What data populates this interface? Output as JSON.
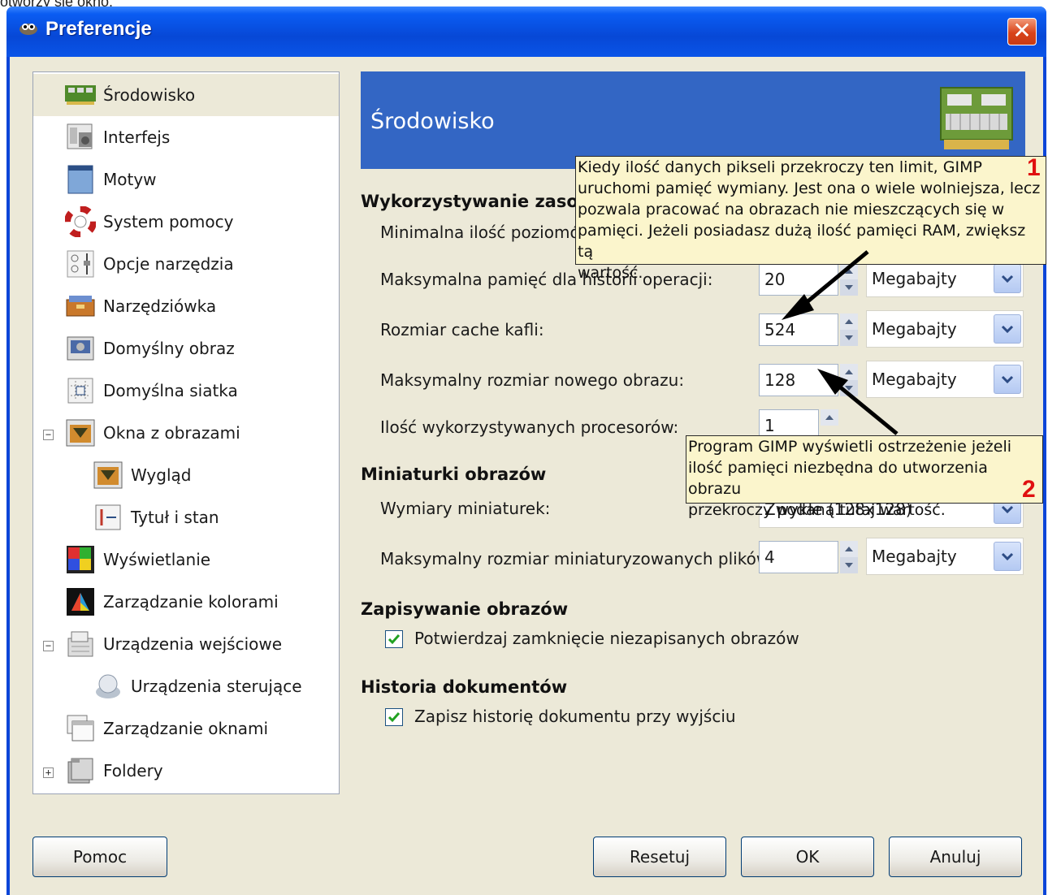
{
  "caption": "otworzy się okno:",
  "window": {
    "title": "Preferencje",
    "close": "✕"
  },
  "sidebar": {
    "items": [
      {
        "label": "Środowisko",
        "icon": "memory-chip-icon"
      },
      {
        "label": "Interfejs",
        "icon": "interface-icon"
      },
      {
        "label": "Motyw",
        "icon": "theme-icon"
      },
      {
        "label": "System pomocy",
        "icon": "lifebuoy-icon"
      },
      {
        "label": "Opcje narzędzia",
        "icon": "tool-options-icon"
      },
      {
        "label": "Narzędziówka",
        "icon": "toolbox-icon"
      },
      {
        "label": "Domyślny obraz",
        "icon": "default-image-icon"
      },
      {
        "label": "Domyślna siatka",
        "icon": "grid-icon"
      },
      {
        "label": "Okna z obrazami",
        "icon": "image-window-icon"
      },
      {
        "label": "Wygląd",
        "icon": "appearance-icon"
      },
      {
        "label": "Tytuł i stan",
        "icon": "title-status-icon"
      },
      {
        "label": "Wyświetlanie",
        "icon": "display-icon"
      },
      {
        "label": "Zarządzanie kolorami",
        "icon": "color-management-icon"
      },
      {
        "label": "Urządzenia wejściowe",
        "icon": "input-devices-icon"
      },
      {
        "label": "Urządzenia sterujące",
        "icon": "controllers-icon"
      },
      {
        "label": "Zarządzanie oknami",
        "icon": "window-management-icon"
      },
      {
        "label": "Foldery",
        "icon": "folders-icon"
      }
    ],
    "selected": "Środowisko"
  },
  "banner": {
    "title": "Środowisko"
  },
  "resources": {
    "title": "Wykorzystywanie zasol",
    "min_undo_label": "Minimalna ilość poziomów",
    "max_undo_mem_label": "Maksymalna pamięć dla historii operacji:",
    "max_undo_mem_value": "20",
    "max_undo_mem_unit": "Megabajty",
    "tile_cache_label": "Rozmiar cache kafli:",
    "tile_cache_value": "524",
    "tile_cache_unit": "Megabajty",
    "max_new_image_label": "Maksymalny rozmiar nowego obrazu:",
    "max_new_image_value": "128",
    "max_new_image_unit": "Megabajty",
    "processors_label": "Ilość wykorzystywanych procesorów:",
    "processors_value": "1"
  },
  "thumbnails": {
    "title": "Miniaturki obrazów",
    "size_label": "Wymiary miniaturek:",
    "size_value": "Zwykłe (128x128)",
    "max_file_label": "Maksymalny rozmiar miniaturyzowanych plików:",
    "max_file_value": "4",
    "max_file_unit": "Megabajty"
  },
  "saving": {
    "title": "Zapisywanie obrazów",
    "confirm_label": "Potwierdzaj zamknięcie niezapisanych obrazów",
    "confirm_checked": true
  },
  "history": {
    "title": "Historia dokumentów",
    "save_label": "Zapisz historię dokumentu przy wyjściu",
    "save_checked": true
  },
  "tooltips": {
    "t1": {
      "number": "1",
      "lines": [
        "Kiedy ilość danych pikseli przekroczy ten limit, GIMP",
        "uruchomi pamięć wymiany. Jest ona o wiele wolniejsza, lecz",
        "pozwala pracować na obrazach nie mieszczących się w",
        "pamięci. Jeżeli posiadasz dużą ilość pamięci RAM, zwiększ tą",
        "wartość."
      ]
    },
    "t2": {
      "number": "2",
      "lines": [
        "Program GIMP wyświetli ostrzeżenie jeżeli",
        "ilość pamięci niezbędna do utworzenia obrazu",
        "przekroczy podaną tutaj wartość."
      ]
    }
  },
  "buttons": {
    "help": "Pomoc",
    "reset": "Resetuj",
    "ok": "OK",
    "cancel": "Anuluj"
  }
}
